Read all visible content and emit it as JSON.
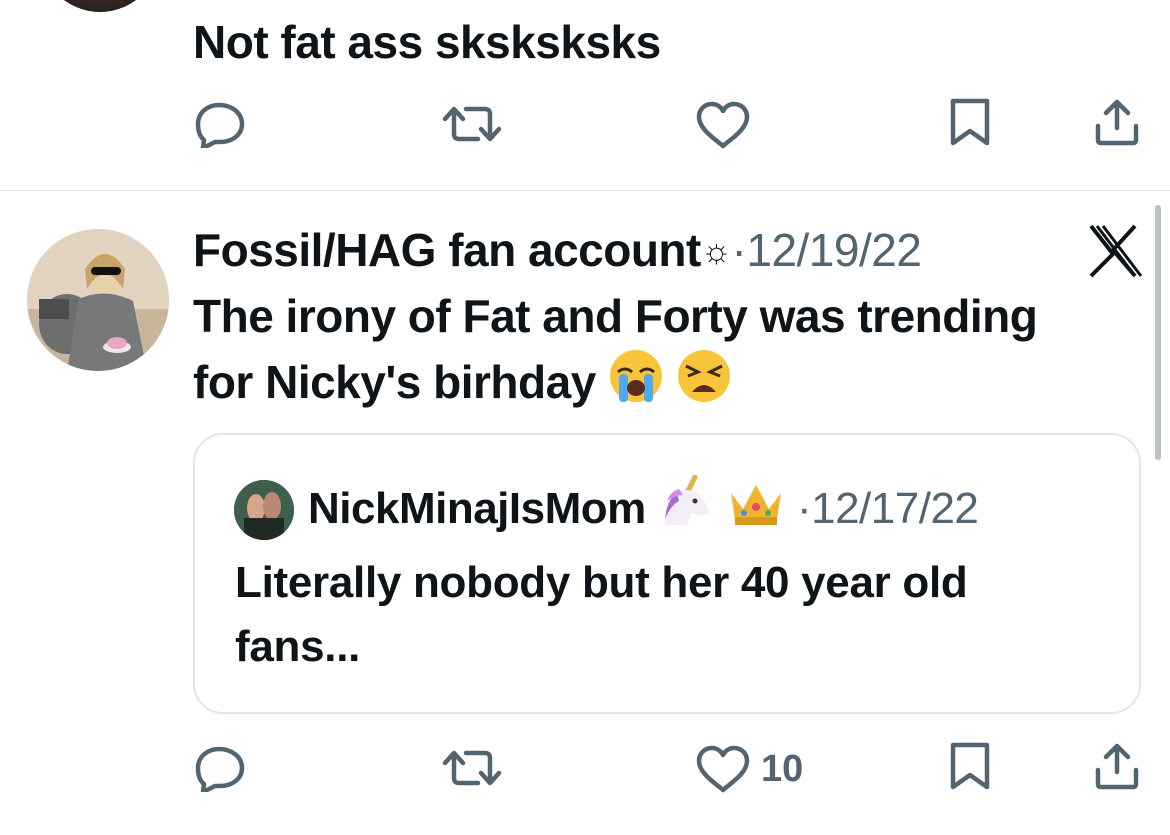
{
  "top_tweet": {
    "text": "Not fat ass sksksksks",
    "actions": {
      "reply_count": "",
      "retweet_count": "",
      "like_count": ""
    }
  },
  "tweet": {
    "display_name": "Fossil/HAG fan account",
    "name_suffix_symbol": "👄",
    "separator": "·",
    "date": "12/19/22",
    "text_line1": "The irony of Fat and Forty was trending",
    "text_line2": "for Nicky's birhday",
    "emoji_1": "crying-face",
    "emoji_2": "weary-face",
    "like_count": "10",
    "close_label": "X"
  },
  "quoted_tweet": {
    "display_name": "NickMinajIsMom",
    "emojis": [
      "unicorn",
      "crown"
    ],
    "separator": "·",
    "date": "12/17/22",
    "text_line1": "Literally nobody but her 40 year old",
    "text_line2": "fans..."
  },
  "colors": {
    "text": "#0f1419",
    "secondary": "#536471",
    "border": "#e1e6ea"
  }
}
